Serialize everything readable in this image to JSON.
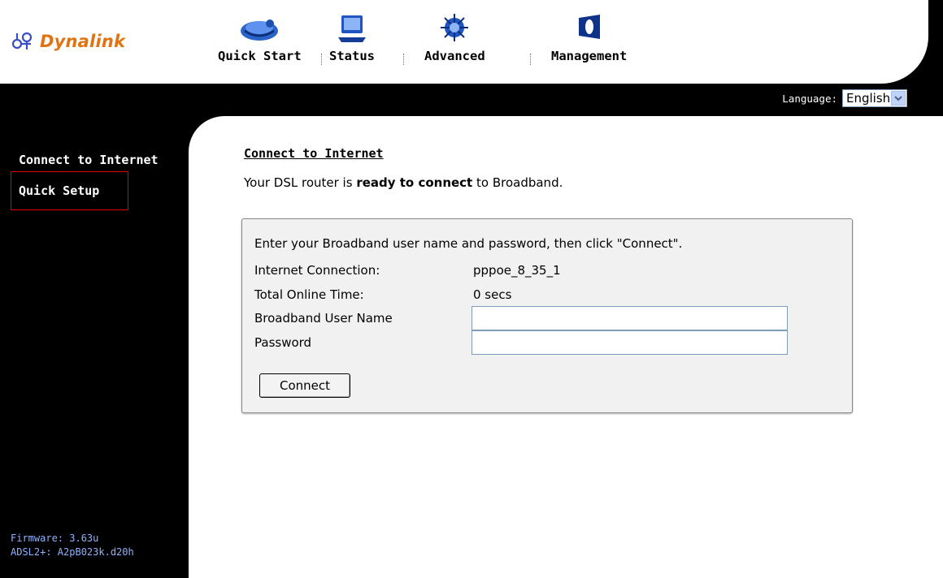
{
  "brand": {
    "logo_text": "Dynalink",
    "logo_color": "#e07412"
  },
  "nav": {
    "items": [
      {
        "label": "Quick Start",
        "icon": "quick-start-icon"
      },
      {
        "label": "Status",
        "icon": "status-icon"
      },
      {
        "label": "Advanced",
        "icon": "advanced-icon"
      },
      {
        "label": "Management",
        "icon": "management-icon"
      }
    ]
  },
  "language": {
    "label": "Language:",
    "selected": "English"
  },
  "sidebar": {
    "items": [
      {
        "label": "Connect to Internet"
      },
      {
        "label": "Quick Setup"
      }
    ],
    "firmware_line": "Firmware: 3.63u",
    "adsl_line": "ADSL2+: A2pB023k.d20h"
  },
  "main": {
    "title": "Connect to Internet",
    "status_prefix": "Your DSL router is ",
    "status_bold": "ready to connect",
    "status_suffix": " to Broadband.",
    "panel": {
      "instructions": "Enter your Broadband user name and password, then click \"Connect\".",
      "connection_label": "Internet Connection:",
      "connection_value": "pppoe_8_35_1",
      "online_time_label": "Total Online Time:",
      "online_time_value": "0 secs",
      "username_label": "Broadband User Name",
      "username_value": "",
      "password_label": "Password",
      "password_value": "",
      "connect_label": "Connect"
    }
  },
  "colors": {
    "frame": "#000000",
    "highlight_box": "#e00000",
    "footer_text": "#8cb3ff",
    "panel_bg": "#f1f1f1"
  }
}
